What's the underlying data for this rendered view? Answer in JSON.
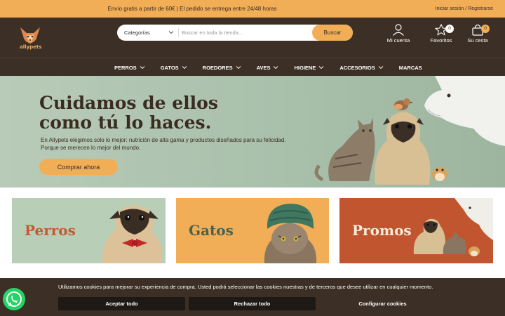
{
  "topbar": {
    "promo_text": "Envío gratis a partir de 60€ | El pedido se entrega entre 24/48 horas",
    "login_label": "Iniciar sesión",
    "separator": " / ",
    "register_label": "Registrarse"
  },
  "header": {
    "logo_text": "allypets",
    "search": {
      "category_label": "Categorías",
      "placeholder": "Buscar en toda la tienda...",
      "button_label": "Buscar"
    },
    "account_label": "Mi cuenta",
    "favorites_label": "Favoritos",
    "favorites_count": "0",
    "cart_label": "Su cesta",
    "cart_count": "0"
  },
  "nav": {
    "items": [
      {
        "label": "PERROS",
        "dropdown": true
      },
      {
        "label": "GATOS",
        "dropdown": true
      },
      {
        "label": "ROEDORES",
        "dropdown": true
      },
      {
        "label": "AVES",
        "dropdown": true
      },
      {
        "label": "HIGIENE",
        "dropdown": true
      },
      {
        "label": "ACCESORIOS",
        "dropdown": true
      },
      {
        "label": "MARCAS",
        "dropdown": false
      }
    ]
  },
  "hero": {
    "title_line1": "Cuidamos de ellos",
    "title_line2": "como tú lo haces.",
    "subtitle_line1": "En Allypets elegimos solo lo mejor: nutrición de alta gama y productos diseñados para su felicidad.",
    "subtitle_line2": "Porque se merecen lo mejor del mundo.",
    "cta_label": "Comprar ahora"
  },
  "categories": [
    {
      "label": "Perros"
    },
    {
      "label": "Gatos"
    },
    {
      "label": "Promos"
    }
  ],
  "cookies": {
    "message": "Utilizamos cookies para mejorar su experiencia de compra. Usted podrá seleccionar las cookies nuestras y de terceros que desee utilizar en cualquier momento.",
    "accept_label": "Aceptar todo",
    "reject_label": "Rechazar todo",
    "configure_label": "Configurar cookies"
  },
  "colors": {
    "brand_orange": "#f2ae57",
    "brand_brown": "#3c2f25",
    "hero_green": "#a9c0ab",
    "promo_red": "#c0552f",
    "whatsapp_green": "#25d366"
  },
  "icons": [
    "fox-logo-icon",
    "chevron-down-icon",
    "user-icon",
    "star-icon",
    "shopping-bag-icon",
    "whatsapp-icon"
  ]
}
